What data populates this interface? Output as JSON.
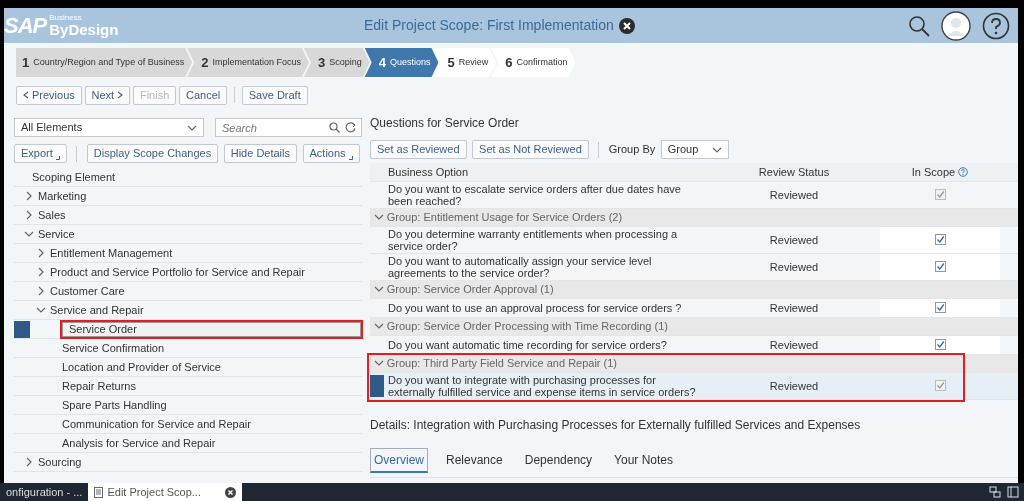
{
  "header": {
    "logo": {
      "brand": "SAP",
      "sup": "Business",
      "product": "ByDesign"
    },
    "title": "Edit Project Scope: First Implementation"
  },
  "steps": [
    {
      "number": "1",
      "label": "Country/Region and Type of Business",
      "completed": true,
      "current": false
    },
    {
      "number": "2",
      "label": "Implementation Focus",
      "completed": true,
      "current": false
    },
    {
      "number": "3",
      "label": "Scoping",
      "completed": true,
      "current": false
    },
    {
      "number": "4",
      "label": "Questions",
      "completed": false,
      "current": true
    },
    {
      "number": "5",
      "label": "Review",
      "completed": false,
      "current": false
    },
    {
      "number": "6",
      "label": "Confirmation",
      "completed": false,
      "current": false
    }
  ],
  "nav_buttons": [
    {
      "label": "Previous",
      "kind": "back",
      "disabled": false
    },
    {
      "label": "Next",
      "kind": "forward",
      "disabled": false
    },
    {
      "label": "Finish",
      "kind": "plain",
      "disabled": true
    },
    {
      "label": "Cancel",
      "kind": "plain",
      "disabled": false
    },
    {
      "label": "Save Draft",
      "kind": "plain",
      "disabled": false
    }
  ],
  "left_panel": {
    "filter": "All Elements",
    "search": {
      "placeholder": "Search"
    },
    "buttons": [
      {
        "label": "Export",
        "menu": true
      },
      {
        "label": "Display Scope Changes",
        "menu": false
      },
      {
        "label": "Hide Details",
        "menu": false
      },
      {
        "label": "Actions",
        "menu": true
      }
    ],
    "column": "Scoping Element",
    "tree": [
      {
        "label": "Marketing",
        "expanded": false,
        "selected": false,
        "highlighted": false
      },
      {
        "label": "Sales",
        "expanded": false,
        "selected": false,
        "highlighted": false
      },
      {
        "label": "Service",
        "expanded": true,
        "selected": false,
        "highlighted": false,
        "children": [
          {
            "label": "Entitlement Management",
            "expanded": false,
            "selected": false,
            "highlighted": false
          },
          {
            "label": "Product and Service Portfolio for Service and Repair",
            "expanded": false,
            "selected": false,
            "highlighted": false
          },
          {
            "label": "Customer Care",
            "expanded": false,
            "selected": false,
            "highlighted": false
          },
          {
            "label": "Service and Repair",
            "expanded": true,
            "selected": false,
            "highlighted": false,
            "children": [
              {
                "label": "Service Order",
                "selected": true,
                "highlighted": true
              },
              {
                "label": "Service Confirmation",
                "selected": false,
                "highlighted": false
              },
              {
                "label": "Location and Provider of Service",
                "selected": false,
                "highlighted": false
              },
              {
                "label": "Repair Returns",
                "selected": false,
                "highlighted": false
              },
              {
                "label": "Spare Parts Handling",
                "selected": false,
                "highlighted": false
              },
              {
                "label": "Communication for Service and Repair",
                "selected": false,
                "highlighted": false
              },
              {
                "label": "Analysis for Service and Repair",
                "selected": false,
                "highlighted": false
              }
            ]
          }
        ]
      },
      {
        "label": "Sourcing",
        "expanded": false,
        "selected": false,
        "highlighted": false
      }
    ]
  },
  "questions": {
    "title": "Questions for Service Order",
    "buttons": [
      "Set as Reviewed",
      "Set as Not Reviewed"
    ],
    "group_by": {
      "label": "Group By",
      "value": "Group"
    },
    "columns": [
      "Business Option",
      "Review Status",
      "In Scope"
    ],
    "rows": [
      {
        "kind": "question",
        "text": "Do you want to escalate service orders after due dates have been reached?",
        "status": "Reviewed",
        "in_scope": true,
        "disabled": true,
        "selected": false
      },
      {
        "kind": "group",
        "text": "Group: Entitlement Usage for Service Orders (2)",
        "expanded": true,
        "highlighted": false
      },
      {
        "kind": "question",
        "text": "Do you determine warranty entitlements when processing a service order?",
        "status": "Reviewed",
        "in_scope": true,
        "disabled": false,
        "selected": false
      },
      {
        "kind": "question",
        "text": "Do you want to automatically assign your service level agreements to the service order?",
        "status": "Reviewed",
        "in_scope": true,
        "disabled": false,
        "selected": false
      },
      {
        "kind": "group",
        "text": "Group: Service Order Approval (1)",
        "expanded": true,
        "highlighted": false
      },
      {
        "kind": "question",
        "text": "Do you want to use an approval process for service orders ?",
        "status": "Reviewed",
        "in_scope": true,
        "disabled": false,
        "selected": false
      },
      {
        "kind": "group",
        "text": "Group: Service Order Processing with Time Recording (1)",
        "expanded": true,
        "highlighted": false
      },
      {
        "kind": "question",
        "text": "Do you want automatic time recording for service orders?",
        "status": "Reviewed",
        "in_scope": true,
        "disabled": false,
        "selected": false
      },
      {
        "kind": "group",
        "text": "Group: Third Party Field Service and Repair (1)",
        "expanded": true,
        "highlighted": true
      },
      {
        "kind": "question",
        "text": "Do you want to integrate with purchasing processes for externally fulfilled service and expense items in service orders?",
        "status": "Reviewed",
        "in_scope": true,
        "disabled": true,
        "selected": true,
        "highlighted": true
      }
    ]
  },
  "details": {
    "title": "Details: Integration with Purchasing Processes for Externally fulfilled Services and Expenses",
    "tabs": [
      {
        "label": "Overview",
        "selected": true
      },
      {
        "label": "Relevance",
        "selected": false
      },
      {
        "label": "Dependency",
        "selected": false
      },
      {
        "label": "Your Notes",
        "selected": false
      }
    ]
  },
  "taskbar": [
    {
      "label": "onfiguration - ...",
      "active": false,
      "closable": false
    },
    {
      "label": "Edit Project Scop...",
      "active": true,
      "closable": true
    }
  ]
}
